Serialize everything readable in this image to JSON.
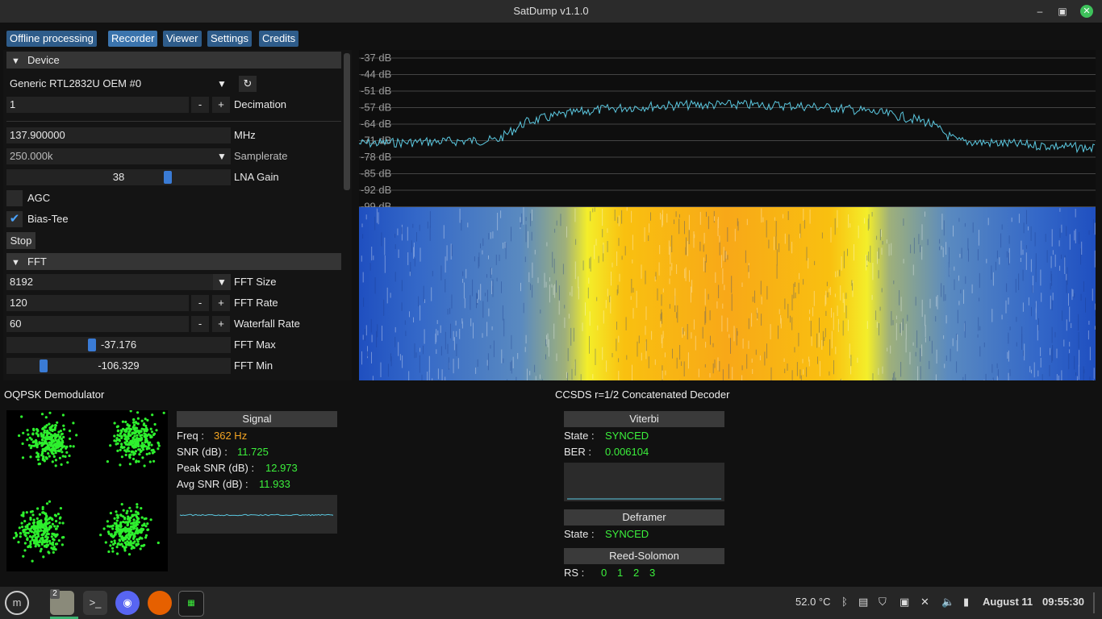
{
  "window": {
    "title": "SatDump v1.1.0"
  },
  "tabs": [
    "Offline processing",
    "Recorder",
    "Viewer",
    "Settings",
    "Credits"
  ],
  "device": {
    "section_label": "Device",
    "device_name": "Generic RTL2832U OEM #0",
    "decimation_value": "1",
    "decimation_label": "Decimation",
    "frequency_value": "137.900000",
    "frequency_unit": "MHz",
    "samplerate_value": "250.000k",
    "samplerate_label": "Samplerate",
    "lna_gain_value": "38",
    "lna_gain_label": "LNA Gain",
    "lna_gain_fraction": 0.72,
    "agc_label": "AGC",
    "agc_checked": false,
    "bias_tee_label": "Bias-Tee",
    "bias_tee_checked": true,
    "stop_label": "Stop"
  },
  "fft": {
    "section_label": "FFT",
    "fft_size_value": "8192",
    "fft_size_label": "FFT Size",
    "fft_rate_value": "120",
    "fft_rate_label": "FFT Rate",
    "waterfall_rate_value": "60",
    "waterfall_rate_label": "Waterfall Rate",
    "fft_max_value": "-37.176",
    "fft_max_label": "FFT Max",
    "fft_min_value": "-106.329",
    "fft_min_label": "FFT Min",
    "minus": "-",
    "plus": "+"
  },
  "spectrum": {
    "db_labels": [
      "-37 dB",
      "-44 dB",
      "-51 dB",
      "-57 dB",
      "-64 dB",
      "-71 dB",
      "-78 dB",
      "-85 dB",
      "-92 dB",
      "-99 dB"
    ],
    "trace_color": "#5bc8e0"
  },
  "demod": {
    "title": "OQPSK Demodulator",
    "signal_header": "Signal",
    "freq_label": "Freq :",
    "freq_value": "362 Hz",
    "snr_label": "SNR (dB) :",
    "snr_value": "11.725",
    "peak_snr_label": "Peak SNR (dB) :",
    "peak_snr_value": "12.973",
    "avg_snr_label": "Avg SNR (dB) :",
    "avg_snr_value": "11.933"
  },
  "decoder": {
    "title": "CCSDS r=1/2 Concatenated Decoder",
    "viterbi_header": "Viterbi",
    "viterbi_state_label": "State :",
    "viterbi_state_value": "SYNCED",
    "ber_label": "BER :",
    "ber_value": "0.006104",
    "deframer_header": "Deframer",
    "deframer_state_label": "State :",
    "deframer_state_value": "SYNCED",
    "rs_header": "Reed-Solomon",
    "rs_label": "RS :",
    "rs_values": [
      "0",
      "1",
      "2",
      "3"
    ]
  },
  "taskbar": {
    "temperature": "52.0 °C",
    "date": "August 11",
    "time": "09:55:30",
    "files_badge": "2"
  },
  "colors": {
    "tab_active": "#3b74ad",
    "tab": "#2e5c8a",
    "accent": "#3a7bd5",
    "ok_green": "#3cf03c",
    "freq_orange": "#f5a623"
  }
}
